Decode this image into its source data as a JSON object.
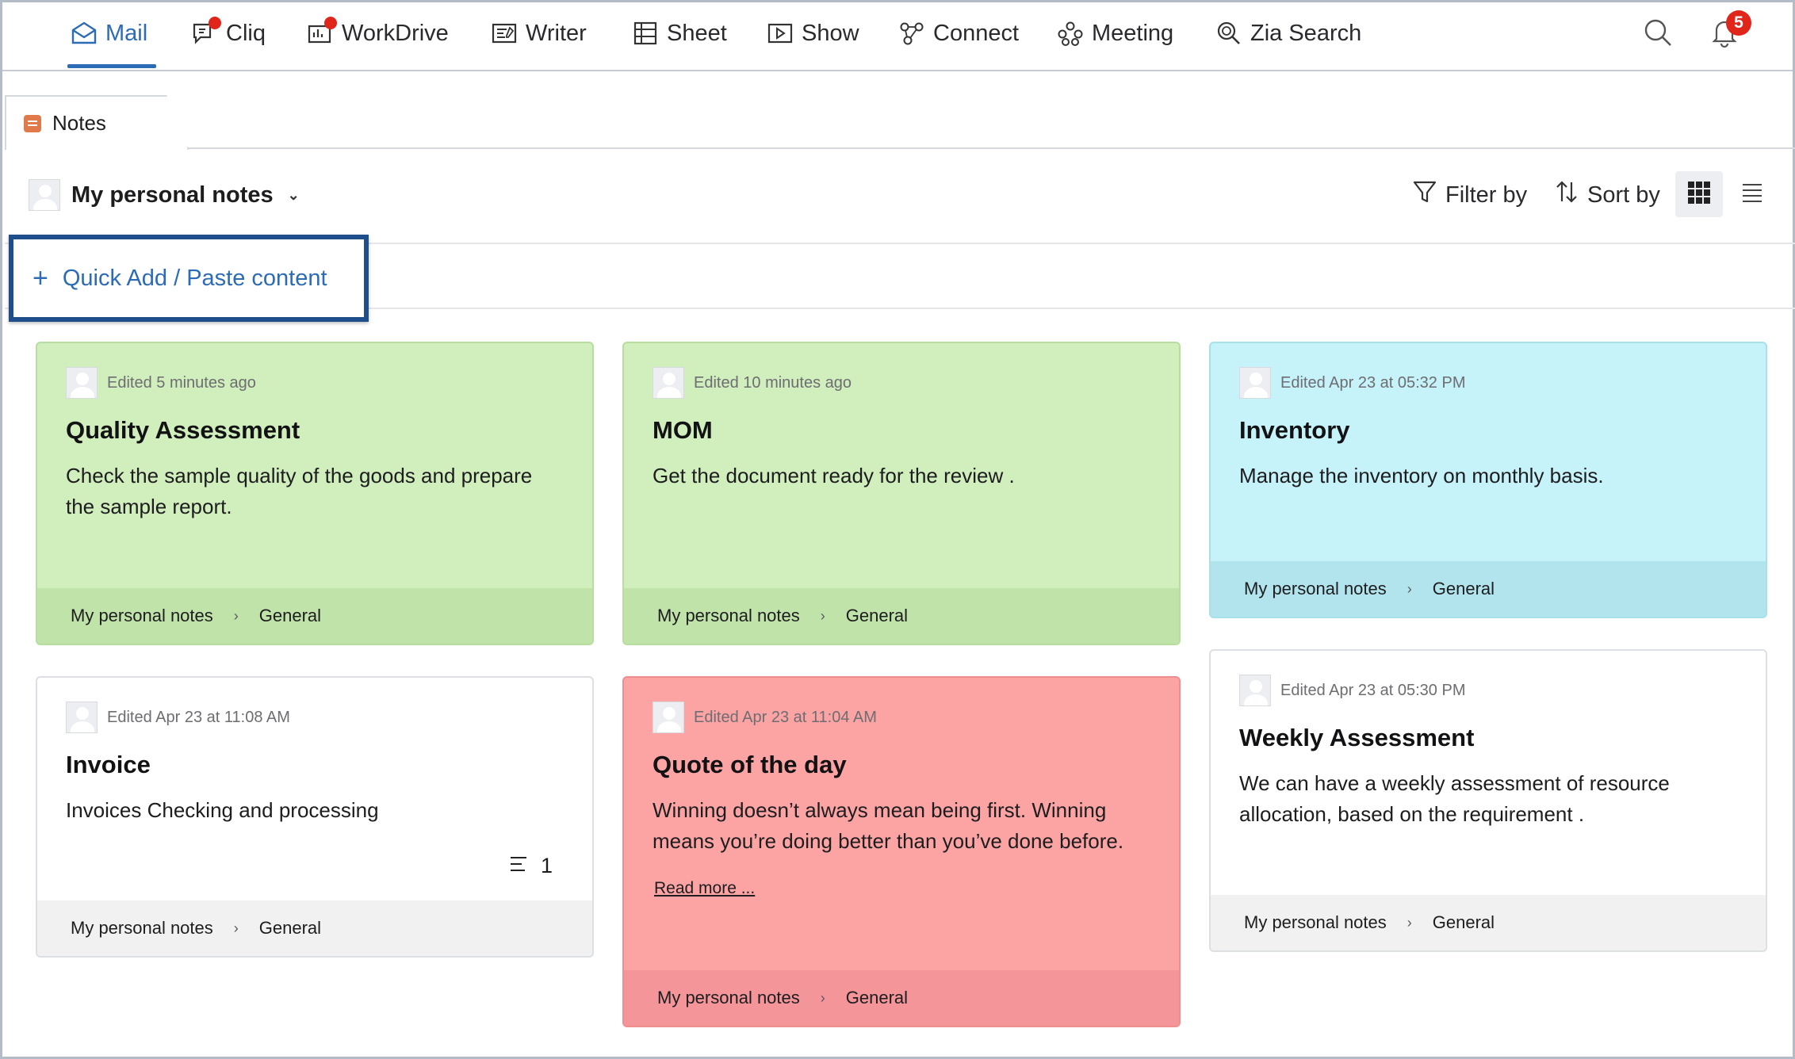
{
  "nav": {
    "items": [
      {
        "label": "Mail",
        "icon": "mail-icon",
        "active": true
      },
      {
        "label": "Cliq",
        "icon": "cliq-icon"
      },
      {
        "label": "WorkDrive",
        "icon": "workdrive-icon"
      },
      {
        "label": "Writer",
        "icon": "writer-icon"
      },
      {
        "label": "Sheet",
        "icon": "sheet-icon"
      },
      {
        "label": "Show",
        "icon": "show-icon"
      },
      {
        "label": "Connect",
        "icon": "connect-icon"
      },
      {
        "label": "Meeting",
        "icon": "meeting-icon"
      },
      {
        "label": "Zia Search",
        "icon": "zia-search-icon"
      }
    ],
    "notification_count": "5",
    "accent": "#2c6bb5",
    "alert_color": "#e0251b"
  },
  "tab": {
    "label": "Notes",
    "icon": "notes-icon"
  },
  "toolbar": {
    "notebook": "My personal notes",
    "filter_label": "Filter by",
    "sort_label": "Sort by",
    "view_mode": "grid"
  },
  "quick_add": {
    "label": "Quick Add / Paste content"
  },
  "notes": [
    {
      "color": "green",
      "edited": "Edited 5 minutes ago",
      "title": "Quality Assessment",
      "body": "Check the sample quality of the goods and prepare the sample report.",
      "notebook": "My personal notes",
      "group": "General"
    },
    {
      "color": "green",
      "edited": "Edited 10 minutes ago",
      "title": "MOM",
      "body": "Get the document ready for the review .",
      "notebook": "My personal notes",
      "group": "General"
    },
    {
      "color": "blue",
      "edited": "Edited Apr 23 at 05:32 PM",
      "title": "Inventory",
      "body": "Manage the inventory on monthly basis.",
      "notebook": "My personal notes",
      "group": "General"
    },
    {
      "color": "white",
      "edited": "Edited Apr 23 at 11:08 AM",
      "title": "Invoice",
      "body": "Invoices Checking and processing",
      "comment_count": "1",
      "notebook": "My personal notes",
      "group": "General"
    },
    {
      "color": "red",
      "edited": "Edited Apr 23 at 11:04 AM",
      "title": "Quote of the day",
      "body": "Winning doesn’t always mean being first. Winning means you’re doing better than you’ve done before.",
      "read_more": "Read more ...",
      "notebook": "My personal notes",
      "group": "General"
    },
    {
      "color": "white",
      "edited": "Edited Apr 23 at 05:30 PM",
      "title": "Weekly Assessment",
      "body": "We can have a weekly assessment of resource allocation, based on the requirement .",
      "notebook": "My personal notes",
      "group": "General"
    }
  ]
}
